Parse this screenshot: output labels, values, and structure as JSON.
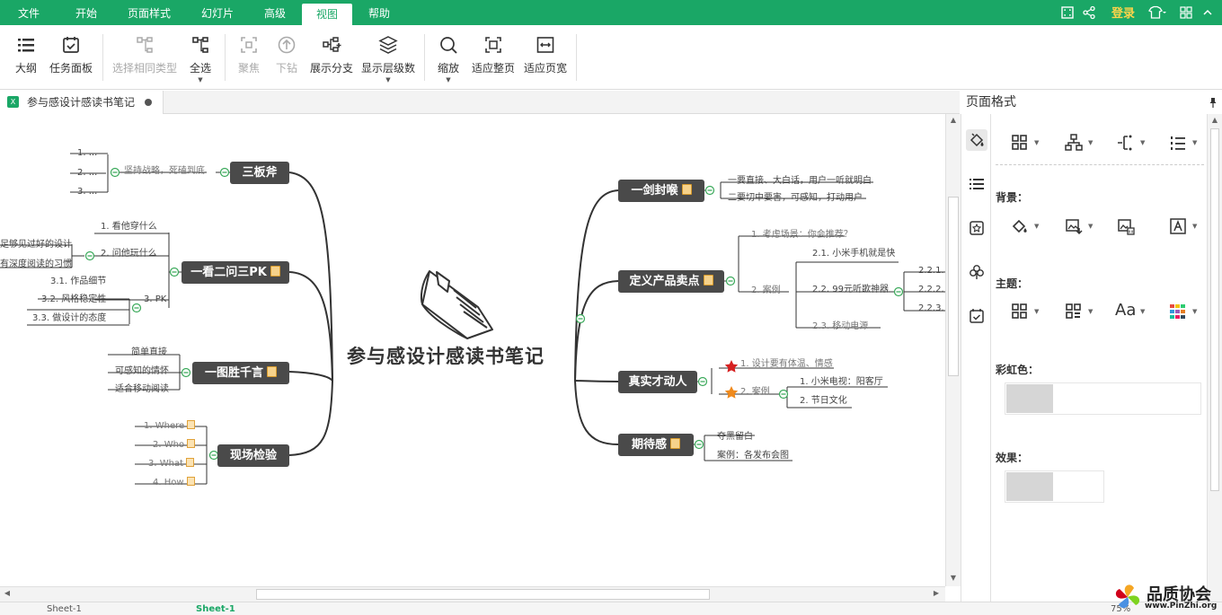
{
  "menubar": {
    "items": [
      "文件",
      "开始",
      "页面样式",
      "幻灯片",
      "高级",
      "视图",
      "帮助"
    ],
    "active": "视图",
    "login": "登录"
  },
  "toolbar": {
    "outline": "大纲",
    "task_panel": "任务面板",
    "select_same_type": "选择相同类型",
    "select_all": "全选",
    "focus": "聚焦",
    "drill_down": "下钻",
    "show_branch": "展示分支",
    "show_levels": "显示层级数",
    "zoom": "缩放",
    "fit_page": "适应整页",
    "fit_width": "适应页宽"
  },
  "document": {
    "tab_title": "参与感设计感读书笔记",
    "file_icon": "X"
  },
  "mindmap": {
    "central": "参与感设计感读书笔记",
    "left": [
      {
        "title": "三板斧",
        "caption": "坚持战略，死磕到底",
        "children": [
          "1. ...",
          "2. ...",
          "3. ..."
        ]
      },
      {
        "title": "一看二问三PK",
        "children": [
          "1. 看他穿什么",
          "2. 问他玩什么",
          "3. PK",
          "足够见过好的设计",
          "有深度阅读的习惯",
          "3.1. 作品细节",
          "3.2. 风格稳定性",
          "3.3. 做设计的态度"
        ]
      },
      {
        "title": "一图胜千言",
        "children": [
          "简单直接",
          "可感知的情怀",
          "适合移动阅读"
        ]
      },
      {
        "title": "现场检验",
        "children": [
          "1. Where",
          "2. Who",
          "3. What",
          "4. How"
        ]
      }
    ],
    "right": [
      {
        "title": "一剑封喉",
        "children": [
          "一要直接、大白话，用户一听就明白",
          "二要切中要害，可感知，打动用户"
        ]
      },
      {
        "title": "定义产品卖点",
        "children": [
          "1. 考虑场景：你会推荐？",
          "2. 案例",
          "2.1. 小米手机就是快",
          "2.2. 99元听歌神器",
          "2.3. 移动电源",
          "2.2.1.",
          "2.2.2.",
          "2.2.3."
        ]
      },
      {
        "title": "真实才动人",
        "children": [
          "1. 设计要有体温、情感",
          "2. 案例",
          "1. 小米电视：阳客厅",
          "2. 节日文化"
        ]
      },
      {
        "title": "期待感",
        "children": [
          "夺黑留白",
          "案例：各发布会图"
        ]
      }
    ]
  },
  "format_panel": {
    "title": "页面格式",
    "background": "背景：",
    "theme": "主题：",
    "rainbow": "彩虹色：",
    "effect": "效果：",
    "theme_font": "Aa"
  },
  "status": {
    "sheet": "Sheet-1",
    "sheet_active": "Sheet-1",
    "zoom": "75%"
  },
  "watermark": {
    "title": "品质协会",
    "url": "www.PinZhi.org"
  },
  "colors": {
    "accent": "#1aa766",
    "node": "#4a4a4a",
    "connector": "#333333",
    "expander": "#3aa95a"
  }
}
